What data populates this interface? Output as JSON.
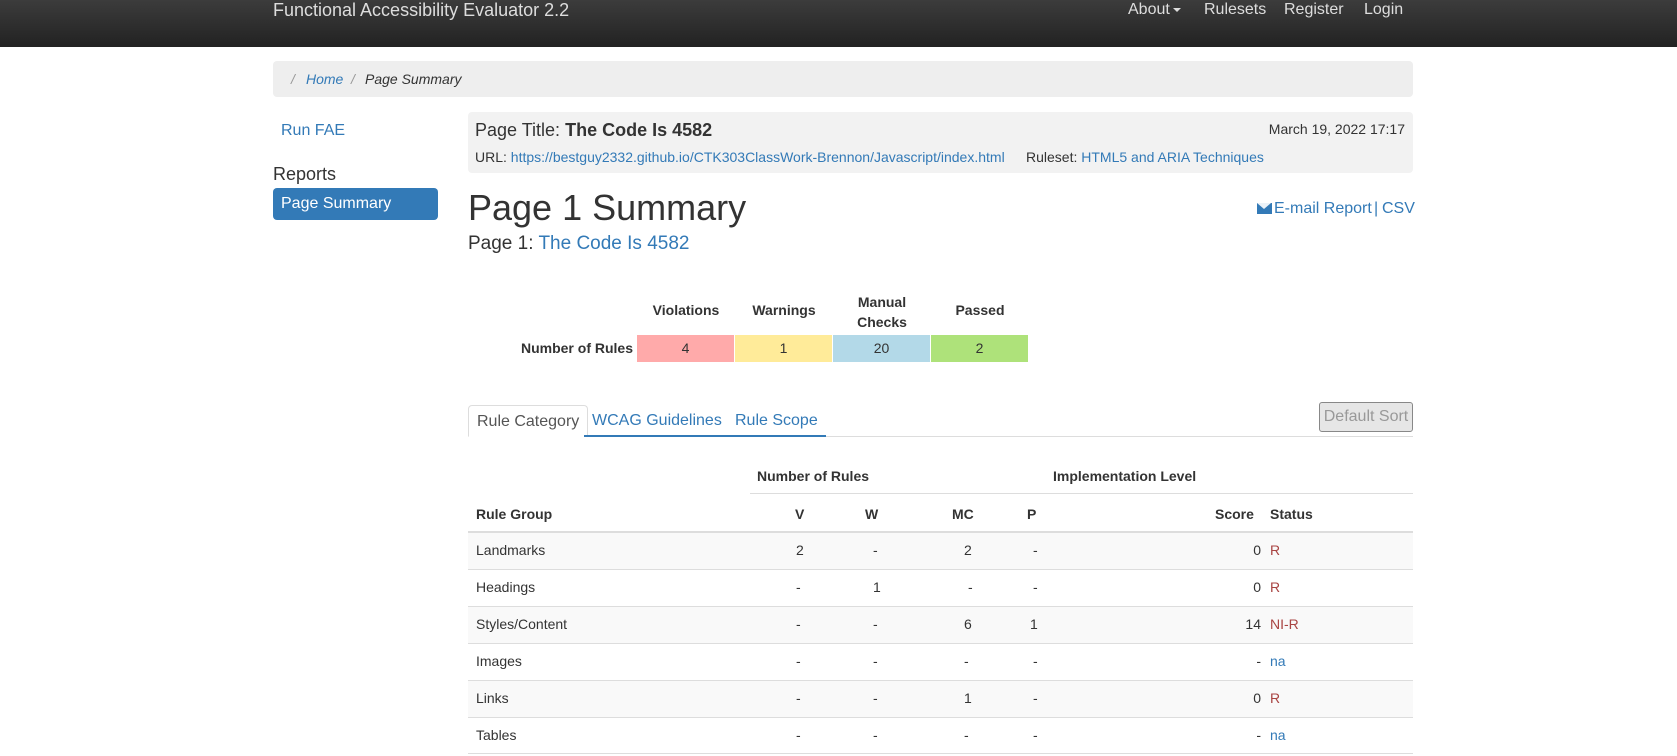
{
  "navbar": {
    "brand": "Functional Accessibility Evaluator 2.2",
    "items": [
      "About",
      "Rulesets",
      "Register",
      "Login"
    ]
  },
  "breadcrumb": {
    "home": "Home",
    "current": "Page Summary"
  },
  "sidebar": {
    "run_fae": "Run FAE",
    "reports_heading": "Reports",
    "active_item": "Page Summary"
  },
  "info": {
    "page_title_label": "Page Title:",
    "page_title": "The Code Is 4582",
    "date": "March 19, 2022 17:17",
    "url_label": "URL:",
    "url": "https://bestguy2332.github.io/CTK303ClassWork-Brennon/Javascript/index.html",
    "ruleset_label": "Ruleset:",
    "ruleset": "HTML5 and ARIA Techniques"
  },
  "heading": "Page 1 Summary",
  "page_link_label": "Page 1:",
  "page_link": "The Code Is 4582",
  "export": {
    "email": "E-mail Report",
    "separator": "|",
    "csv": "CSV"
  },
  "summary": {
    "row_label": "Number of Rules",
    "headers": [
      "Violations",
      "Warnings",
      "Manual Checks",
      "Passed"
    ],
    "values": [
      "4",
      "1",
      "20",
      "2"
    ],
    "colors": [
      "#ffaaaa",
      "#ffeb99",
      "#b3d9e8",
      "#aee27a"
    ]
  },
  "tabs": [
    "Rule Category",
    "WCAG Guidelines",
    "Rule Scope"
  ],
  "default_sort": "Default Sort",
  "table": {
    "group_headers": [
      "Number of Rules",
      "Implementation Level"
    ],
    "columns": [
      "Rule Group",
      "V",
      "W",
      "MC",
      "P",
      "Score",
      "Status"
    ],
    "rows": [
      [
        "Landmarks",
        "2",
        "-",
        "2",
        "-",
        "0",
        "R"
      ],
      [
        "Headings",
        "-",
        "1",
        "-",
        "-",
        "0",
        "R"
      ],
      [
        "Styles/Content",
        "-",
        "-",
        "6",
        "1",
        "14",
        "NI-R"
      ],
      [
        "Images",
        "-",
        "-",
        "-",
        "-",
        "-",
        "na"
      ],
      [
        "Links",
        "-",
        "-",
        "1",
        "-",
        "0",
        "R"
      ],
      [
        "Tables",
        "-",
        "-",
        "-",
        "-",
        "-",
        "na"
      ]
    ]
  }
}
